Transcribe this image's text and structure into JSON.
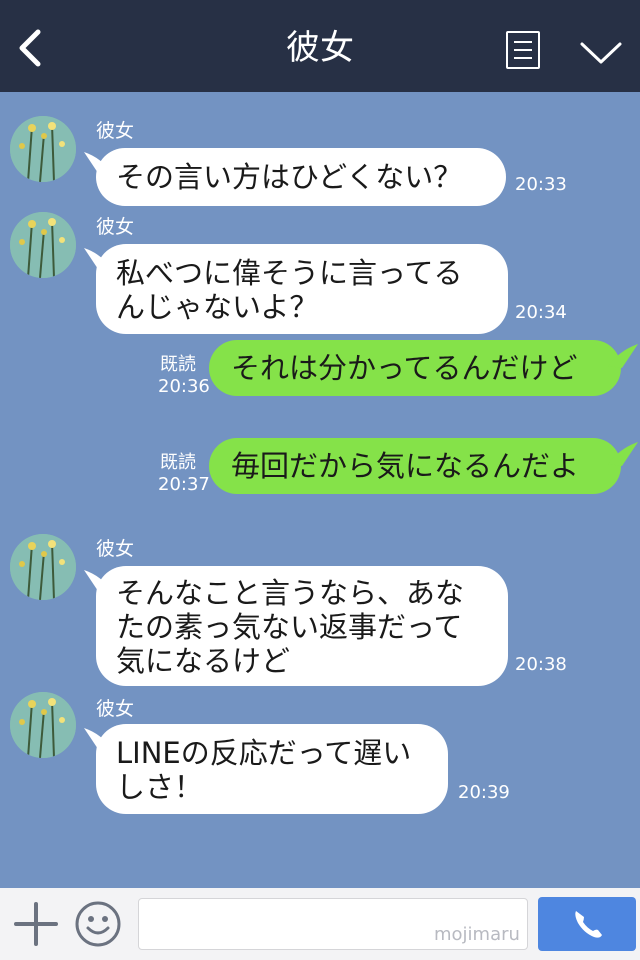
{
  "header": {
    "title": "彼女"
  },
  "messages": [
    {
      "type": "in",
      "sender": "彼女",
      "text": "その言い方はひどくない？",
      "time": "20:33"
    },
    {
      "type": "in",
      "sender": "彼女",
      "text": "私べつに偉そうに言ってる\nんじゃないよ？",
      "time": "20:34"
    },
    {
      "type": "out",
      "read": "既読",
      "text": "それは分かってるんだけど",
      "time": "20:36"
    },
    {
      "type": "out",
      "read": "既読",
      "text": "毎回だから気になるんだよ",
      "time": "20:37"
    },
    {
      "type": "in",
      "sender": "彼女",
      "text": "そんなこと言うなら、あな\nたの素っ気ない返事だって\n気になるけど",
      "time": "20:38"
    },
    {
      "type": "in",
      "sender": "彼女",
      "text": "LINEの反応だって遅い\nしさ！",
      "time": "20:39"
    }
  ],
  "footer": {
    "watermark": "mojimaru"
  },
  "colors": {
    "header": "#273045",
    "chat_bg": "#7393c2",
    "outgoing": "#85e249",
    "incoming": "#ffffff",
    "call_button": "#4e86e0"
  }
}
